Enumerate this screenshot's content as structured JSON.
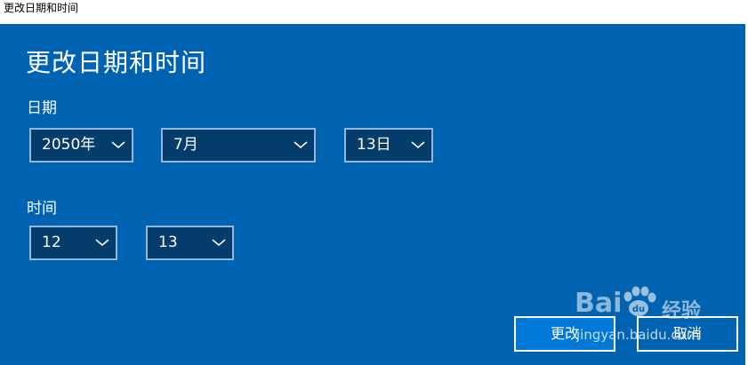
{
  "window": {
    "title": "更改日期和时间"
  },
  "dialog": {
    "heading": "更改日期和时间",
    "date_label": "日期",
    "time_label": "时间",
    "year": "2050年",
    "month": "7月",
    "day": "13日",
    "hour": "12",
    "minute": "13",
    "change_button": "更改",
    "cancel_button": "取消"
  },
  "watermark": {
    "logo": "Bai",
    "logo_suffix": "经验",
    "url": "jingyan.baidu.com"
  },
  "colors": {
    "panel": "#0063b1",
    "dropdown_fill": "#043d6b",
    "dropdown_border": "#8fb8dc",
    "primary_button": "#0078d7"
  },
  "icons": {
    "dropdown": "chevron-down-icon",
    "watermark": "paw-icon"
  }
}
